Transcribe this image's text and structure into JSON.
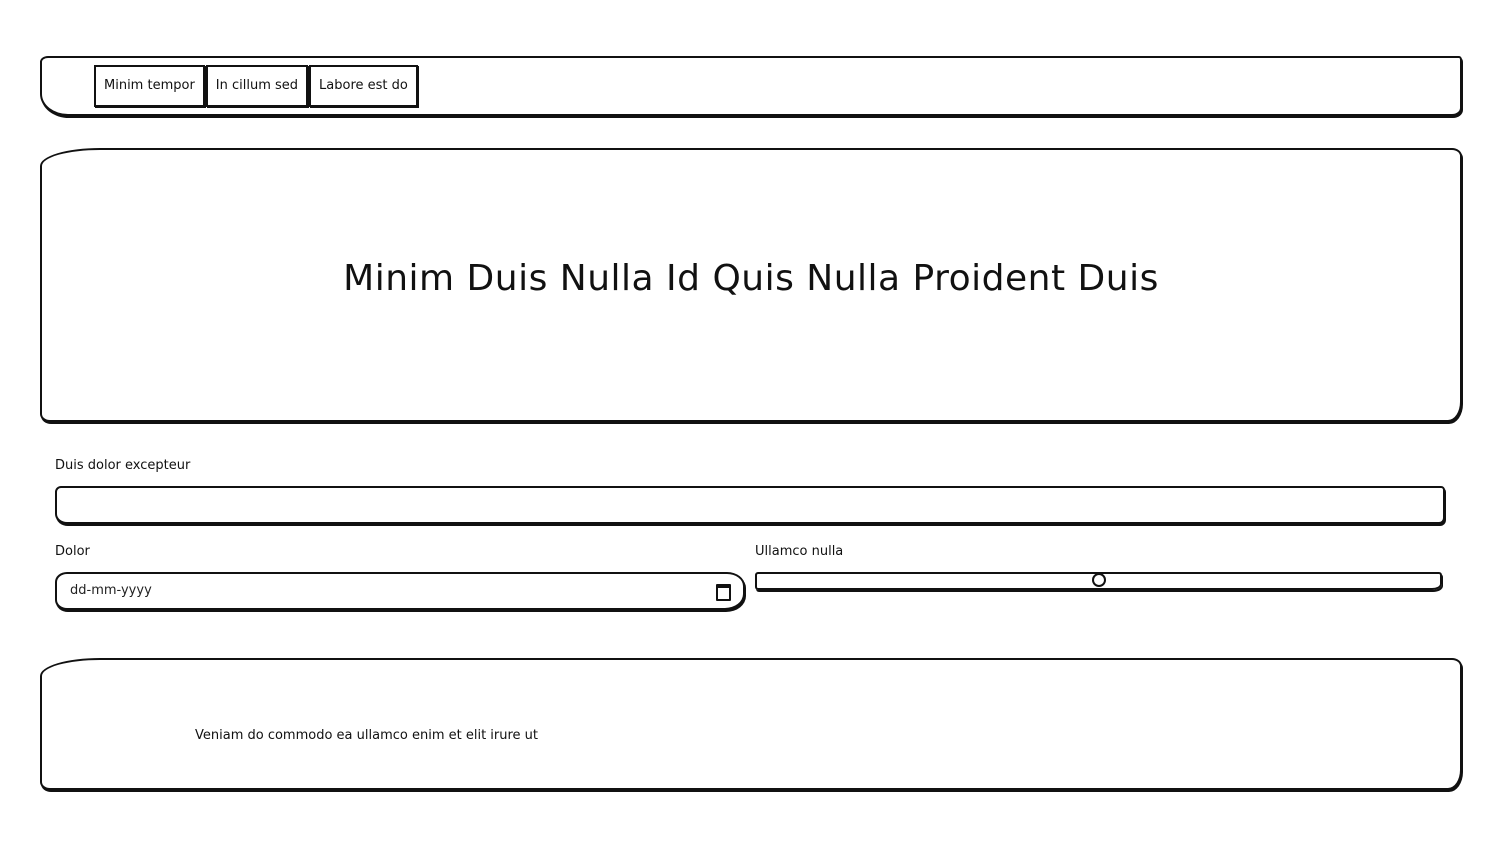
{
  "navbar": {
    "tabs": [
      {
        "label": "Minim tempor"
      },
      {
        "label": "In cillum sed"
      },
      {
        "label": "Labore est do"
      }
    ]
  },
  "hero": {
    "title": "Minim Duis Nulla Id Quis Nulla Proident Duis"
  },
  "form": {
    "text_field": {
      "label": "Duis dolor excepteur",
      "value": ""
    },
    "date_field": {
      "label": "Dolor",
      "placeholder": "dd-mm-yyyy",
      "icon": "calendar-icon"
    },
    "range_field": {
      "label": "Ullamco nulla",
      "value_fraction": 0.5
    }
  },
  "footer": {
    "text": "Veniam do commodo ea ullamco enim et elit irure ut"
  }
}
